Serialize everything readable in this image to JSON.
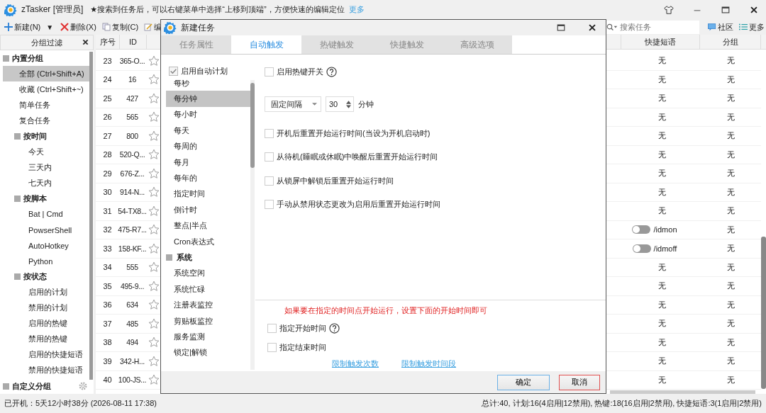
{
  "window": {
    "title": "zTasker [管理员]",
    "notice": "★搜索到任务后，可以右键菜单中选择“上移到顶端”，方便快速的编辑定位",
    "notice_link": "更多"
  },
  "toolbar": {
    "new": "新建(N)",
    "dropdown": "▼",
    "delete": "删除(X)",
    "copy": "复制(C)",
    "edit": "编",
    "search": {
      "placeholder": "搜索任务"
    },
    "community": "社区",
    "more": "更多"
  },
  "sidebar": {
    "title": "分组过滤",
    "groups": [
      {
        "label": "内置分组",
        "children": [
          {
            "label": "全部 (Ctrl+Shift+A)",
            "selected": true
          },
          {
            "label": "收藏 (Ctrl+Shift+~)",
            "selected": false
          },
          {
            "label": "简单任务",
            "selected": false
          },
          {
            "label": "复合任务",
            "selected": false
          },
          {
            "label": "按时间",
            "children": [
              {
                "label": "今天",
                "selected": false
              },
              {
                "label": "三天内",
                "selected": false
              },
              {
                "label": "七天内",
                "selected": false
              }
            ]
          },
          {
            "label": "按脚本",
            "children": [
              {
                "label": "Bat | Cmd",
                "selected": false
              },
              {
                "label": "PowserShell",
                "selected": false
              },
              {
                "label": "AutoHotkey",
                "selected": false
              },
              {
                "label": "Python",
                "selected": false
              }
            ]
          },
          {
            "label": "按状态",
            "children": [
              {
                "label": "启用的计划",
                "selected": false
              },
              {
                "label": "禁用的计划",
                "selected": false
              },
              {
                "label": "启用的热键",
                "selected": false
              },
              {
                "label": "禁用的热键",
                "selected": false
              },
              {
                "label": "启用的快捷短语",
                "selected": false
              },
              {
                "label": "禁用的快捷短语",
                "selected": false
              }
            ]
          }
        ]
      },
      {
        "label": "自定义分组"
      }
    ]
  },
  "table": {
    "columns": [
      "序号",
      "ID",
      "快捷短语",
      "分组"
    ],
    "rows": [
      {
        "seq": "23",
        "id": "365-O...",
        "starred": false,
        "phrase": {
          "kind": "text",
          "text": "无"
        },
        "group": "无"
      },
      {
        "seq": "24",
        "id": "16",
        "starred": false,
        "phrase": {
          "kind": "text",
          "text": "无"
        },
        "group": "无"
      },
      {
        "seq": "25",
        "id": "427",
        "starred": false,
        "phrase": {
          "kind": "text",
          "text": "无"
        },
        "group": "无"
      },
      {
        "seq": "26",
        "id": "565",
        "starred": false,
        "phrase": {
          "kind": "text",
          "text": "无"
        },
        "group": "无"
      },
      {
        "seq": "27",
        "id": "800",
        "starred": false,
        "phrase": {
          "kind": "text",
          "text": "无"
        },
        "group": "无"
      },
      {
        "seq": "28",
        "id": "520-Q...",
        "starred": false,
        "phrase": {
          "kind": "text",
          "text": "无"
        },
        "group": "无"
      },
      {
        "seq": "29",
        "id": "676-Z...",
        "starred": false,
        "phrase": {
          "kind": "text",
          "text": "无"
        },
        "group": "无"
      },
      {
        "seq": "30",
        "id": "914-N...",
        "starred": false,
        "phrase": {
          "kind": "text",
          "text": "无"
        },
        "group": "无"
      },
      {
        "seq": "31",
        "id": "54-TX8...",
        "starred": false,
        "phrase": {
          "kind": "text",
          "text": "无"
        },
        "group": "无"
      },
      {
        "seq": "32",
        "id": "475-R7...",
        "starred": false,
        "phrase": {
          "kind": "toggle",
          "on": false,
          "text": "/idmon"
        },
        "group": "无"
      },
      {
        "seq": "33",
        "id": "158-KF...",
        "starred": false,
        "phrase": {
          "kind": "toggle",
          "on": false,
          "text": "/idmoff"
        },
        "group": "无"
      },
      {
        "seq": "34",
        "id": "555",
        "starred": false,
        "phrase": {
          "kind": "text",
          "text": "无"
        },
        "group": "无"
      },
      {
        "seq": "35",
        "id": "495-9...",
        "starred": false,
        "phrase": {
          "kind": "text",
          "text": "无"
        },
        "group": "无"
      },
      {
        "seq": "36",
        "id": "634",
        "starred": false,
        "phrase": {
          "kind": "text",
          "text": "无"
        },
        "group": "无"
      },
      {
        "seq": "37",
        "id": "485",
        "starred": false,
        "phrase": {
          "kind": "text",
          "text": "无"
        },
        "group": "无"
      },
      {
        "seq": "38",
        "id": "494",
        "starred": false,
        "phrase": {
          "kind": "text",
          "text": "无"
        },
        "group": "无"
      },
      {
        "seq": "39",
        "id": "342-H...",
        "starred": false,
        "phrase": {
          "kind": "text",
          "text": "无"
        },
        "group": "无"
      },
      {
        "seq": "40",
        "id": "100-JS...",
        "starred": false,
        "phrase": {
          "kind": "text",
          "text": "无"
        },
        "group": "无"
      }
    ]
  },
  "dialog": {
    "title": "新建任务",
    "tabs": [
      {
        "label": "任务属性",
        "selected": false
      },
      {
        "label": "自动触发",
        "selected": true
      },
      {
        "label": "热键触发",
        "selected": false
      },
      {
        "label": "快捷触发",
        "selected": false
      },
      {
        "label": "高级选项",
        "selected": false
      }
    ],
    "auto_plan": {
      "label": "启用自动计划",
      "checked": true
    },
    "triggers": [
      {
        "kind": "item",
        "label": "每秒",
        "selected": false
      },
      {
        "kind": "item",
        "label": "每分钟",
        "selected": true
      },
      {
        "kind": "item",
        "label": "每小时",
        "selected": false
      },
      {
        "kind": "item",
        "label": "每天",
        "selected": false
      },
      {
        "kind": "item",
        "label": "每周的",
        "selected": false
      },
      {
        "kind": "item",
        "label": "每月",
        "selected": false
      },
      {
        "kind": "item",
        "label": "每年的",
        "selected": false
      },
      {
        "kind": "item",
        "label": "指定时间",
        "selected": false
      },
      {
        "kind": "item",
        "label": "倒计时",
        "selected": false
      },
      {
        "kind": "item",
        "label": "整点|半点",
        "selected": false
      },
      {
        "kind": "item",
        "label": "Cron表达式",
        "selected": false
      },
      {
        "kind": "group",
        "label": "系统"
      },
      {
        "kind": "item",
        "label": "系统空闲",
        "selected": false
      },
      {
        "kind": "item",
        "label": "系统忙碌",
        "selected": false
      },
      {
        "kind": "item",
        "label": "注册表监控",
        "selected": false
      },
      {
        "kind": "item",
        "label": "剪贴板监控",
        "selected": false
      },
      {
        "kind": "item",
        "label": "服务监测",
        "selected": false
      },
      {
        "kind": "item",
        "label": "锁定|解锁",
        "selected": false
      }
    ],
    "hotkey_switch": {
      "label": "启用热键开关",
      "checked": false
    },
    "interval": {
      "mode": "固定间隔",
      "value": "30",
      "unit": "分钟"
    },
    "reset_options": [
      {
        "label": "开机后重置开始运行时间(当设为开机启动时)",
        "checked": false
      },
      {
        "label": "从待机(睡眠或休眠)中唤醒后重置开始运行时间",
        "checked": false
      },
      {
        "label": "从锁屏中解锁后重置开始运行时间",
        "checked": false
      },
      {
        "label": "手动从禁用状态更改为启用后重置开始运行时间",
        "checked": false
      }
    ],
    "note": "如果要在指定的时间点开始运行，设置下面的开始时间即可",
    "time_options": [
      {
        "label": "指定开始时间",
        "checked": false,
        "help": true
      },
      {
        "label": "指定结束时间",
        "checked": false,
        "help": false
      }
    ],
    "links": [
      "限制触发次数",
      "限制触发时间段"
    ],
    "ok": "确定",
    "cancel": "取消"
  },
  "status_bar": {
    "uptime": "已开机：5天12小时38分 (2026-08-11 17:38)",
    "summary": "总计:40, 计划:16(4启用|12禁用), 热键:18(16启用|2禁用), 快捷短语:3(1启用|2禁用)"
  }
}
